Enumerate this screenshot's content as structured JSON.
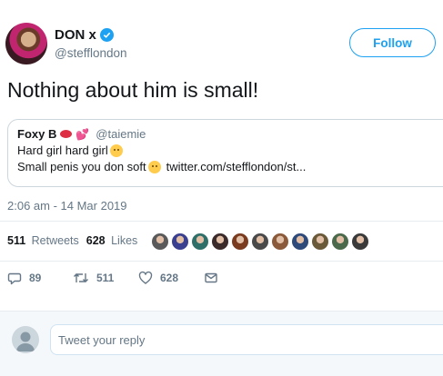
{
  "author": {
    "name": "DON x",
    "handle": "@stefflondon",
    "follow_label": "Follow"
  },
  "tweet": {
    "text": "Nothing about him is small!",
    "timestamp": "2:06 am - 14 Mar 2019"
  },
  "quote": {
    "name": "Foxy B",
    "handle": "@taiemie",
    "line1": "Hard girl hard girl",
    "line2_text": "Small penis you don soft",
    "line2_link": "twitter.com/stefflondon/st..."
  },
  "stats": {
    "retweets_count": "511",
    "retweets_label": "Retweets",
    "likes_count": "628",
    "likes_label": "Likes",
    "liker_colors": [
      "#5a5a5a",
      "#3b3f8f",
      "#2f6f6a",
      "#3c2b2b",
      "#7a3b1f",
      "#4a4a4a",
      "#8a5a3a",
      "#2d4a7a",
      "#6b5a3a",
      "#4b6a4b",
      "#3a3a3a"
    ]
  },
  "actions": {
    "reply_count": "89",
    "retweet_count": "511",
    "like_count": "628"
  },
  "reply": {
    "placeholder": "Tweet your reply"
  },
  "colors": {
    "accent": "#1da1f2",
    "muted": "#657786"
  }
}
